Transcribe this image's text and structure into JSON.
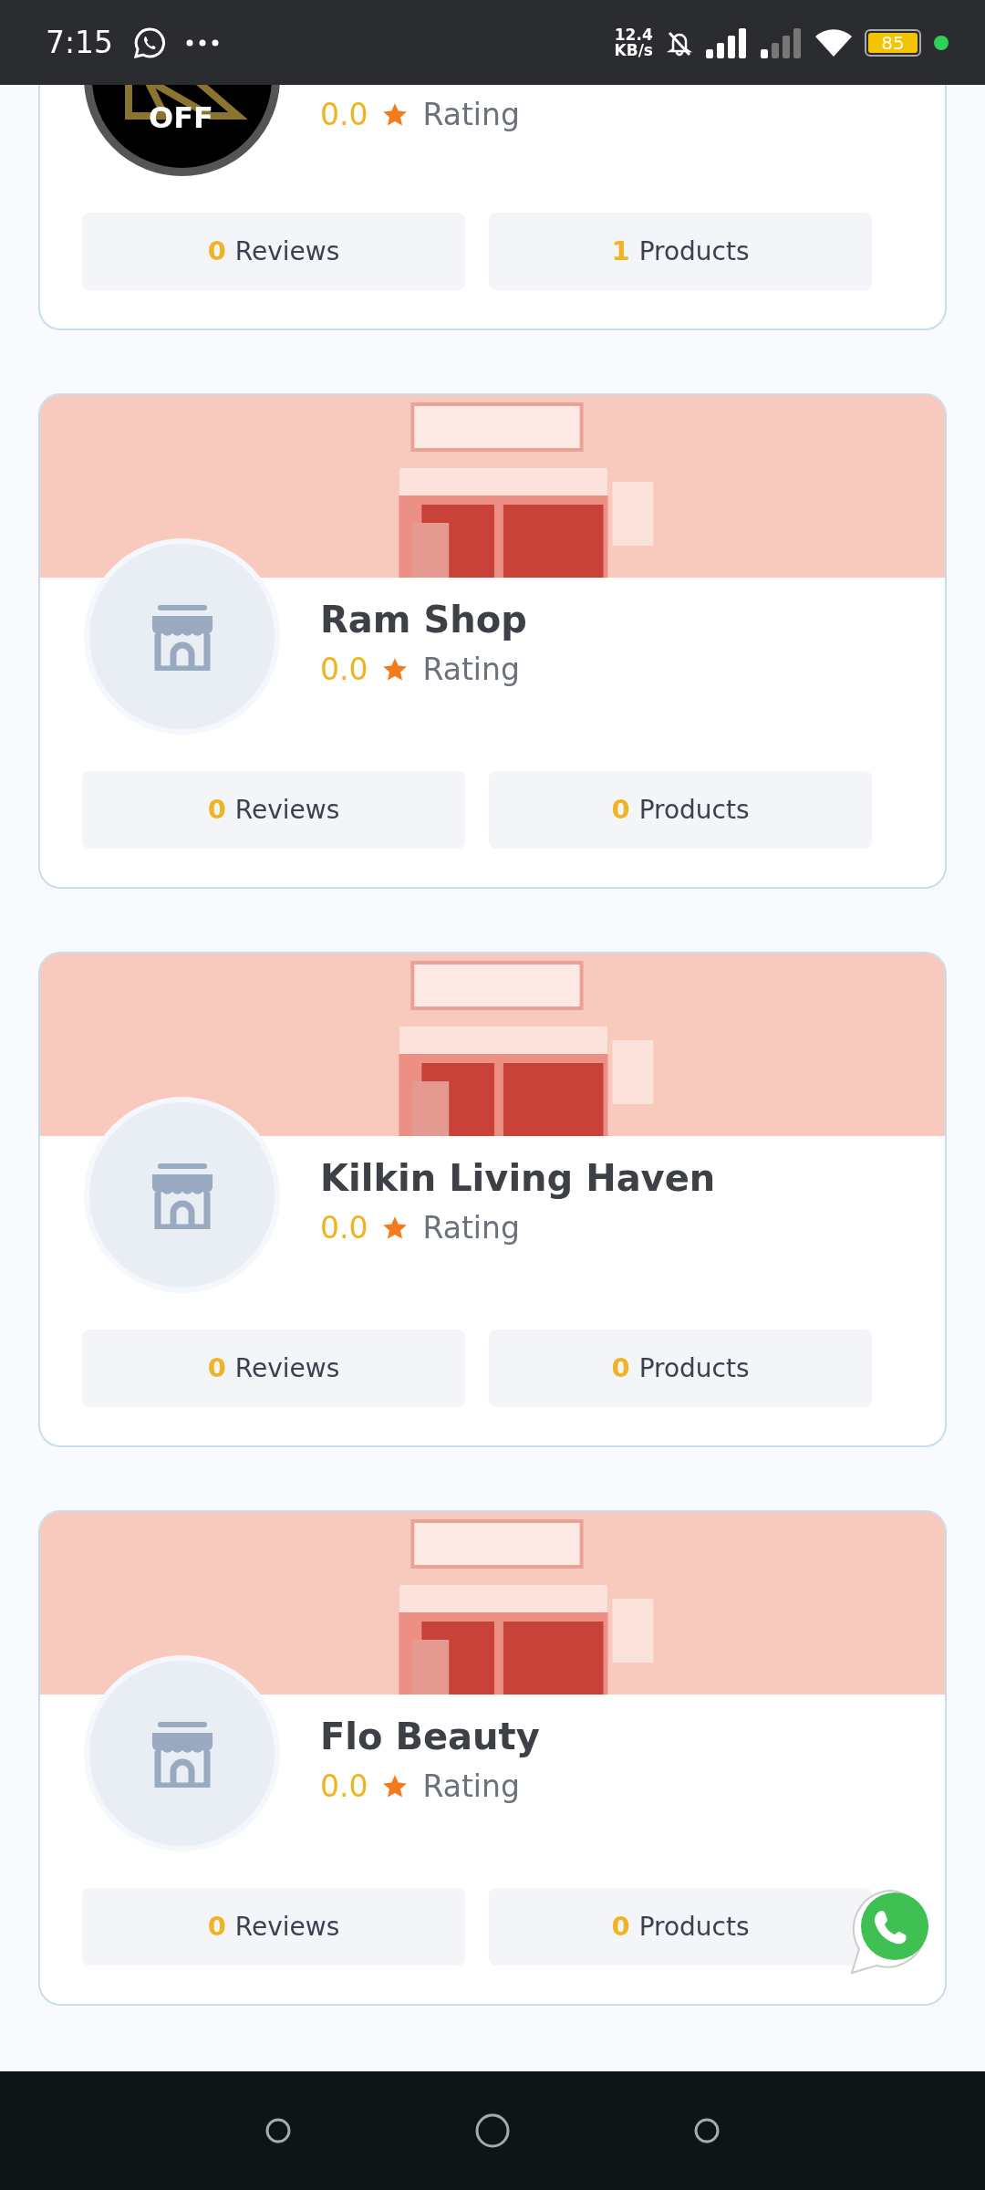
{
  "status_bar": {
    "time": "7:15",
    "speed_value": "12.4",
    "speed_unit": "KB/s",
    "battery": "85"
  },
  "stores": [
    {
      "kind": "logo",
      "logo_text": "OFF",
      "rating": "0.0",
      "rating_label": "Rating",
      "reviews_count": "0",
      "reviews_label": "Reviews",
      "products_count": "1",
      "products_label": "Products"
    },
    {
      "kind": "store",
      "name": "Ram Shop",
      "rating": "0.0",
      "rating_label": "Rating",
      "reviews_count": "0",
      "reviews_label": "Reviews",
      "products_count": "0",
      "products_label": "Products"
    },
    {
      "kind": "store",
      "name": "Kilkin Living Haven",
      "rating": "0.0",
      "rating_label": "Rating",
      "reviews_count": "0",
      "reviews_label": "Reviews",
      "products_count": "0",
      "products_label": "Products"
    },
    {
      "kind": "store",
      "name": "Flo Beauty",
      "rating": "0.0",
      "rating_label": "Rating",
      "reviews_count": "0",
      "reviews_label": "Reviews",
      "products_count": "0",
      "products_label": "Products"
    }
  ]
}
